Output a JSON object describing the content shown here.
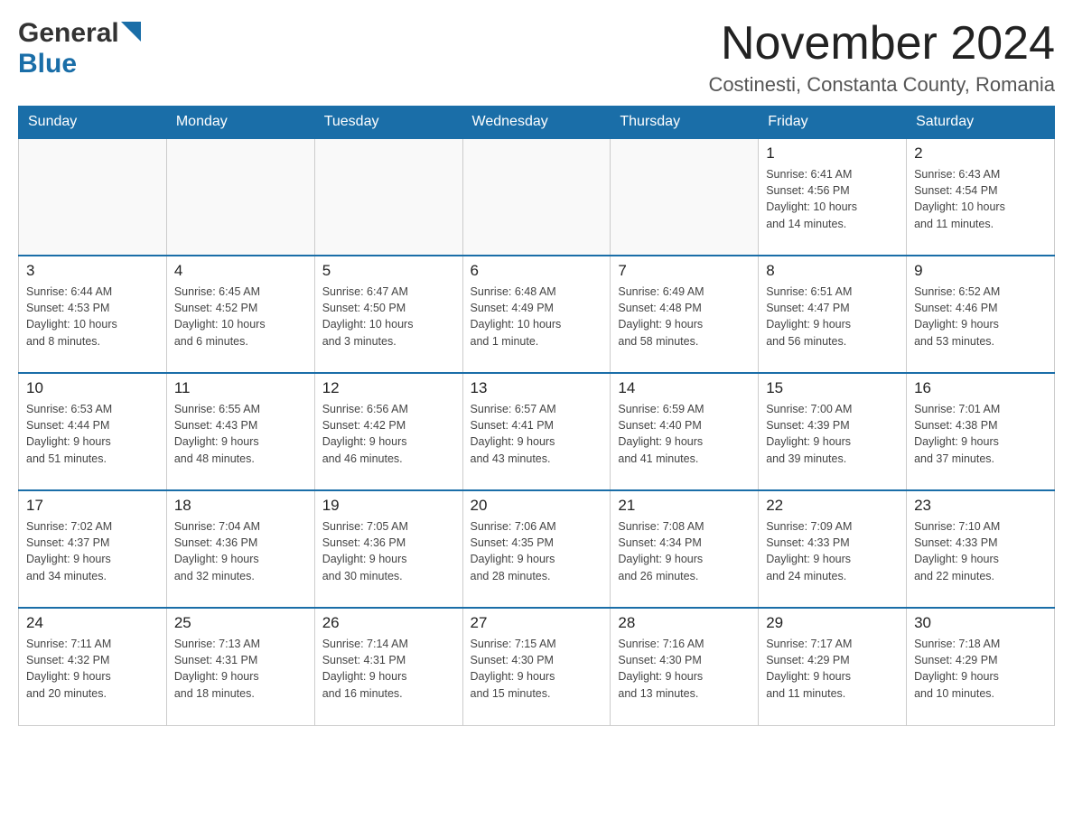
{
  "header": {
    "logo_general": "General",
    "logo_blue": "Blue",
    "month_title": "November 2024",
    "location": "Costinesti, Constanta County, Romania"
  },
  "weekdays": [
    "Sunday",
    "Monday",
    "Tuesday",
    "Wednesday",
    "Thursday",
    "Friday",
    "Saturday"
  ],
  "weeks": [
    [
      {
        "day": "",
        "info": ""
      },
      {
        "day": "",
        "info": ""
      },
      {
        "day": "",
        "info": ""
      },
      {
        "day": "",
        "info": ""
      },
      {
        "day": "",
        "info": ""
      },
      {
        "day": "1",
        "info": "Sunrise: 6:41 AM\nSunset: 4:56 PM\nDaylight: 10 hours\nand 14 minutes."
      },
      {
        "day": "2",
        "info": "Sunrise: 6:43 AM\nSunset: 4:54 PM\nDaylight: 10 hours\nand 11 minutes."
      }
    ],
    [
      {
        "day": "3",
        "info": "Sunrise: 6:44 AM\nSunset: 4:53 PM\nDaylight: 10 hours\nand 8 minutes."
      },
      {
        "day": "4",
        "info": "Sunrise: 6:45 AM\nSunset: 4:52 PM\nDaylight: 10 hours\nand 6 minutes."
      },
      {
        "day": "5",
        "info": "Sunrise: 6:47 AM\nSunset: 4:50 PM\nDaylight: 10 hours\nand 3 minutes."
      },
      {
        "day": "6",
        "info": "Sunrise: 6:48 AM\nSunset: 4:49 PM\nDaylight: 10 hours\nand 1 minute."
      },
      {
        "day": "7",
        "info": "Sunrise: 6:49 AM\nSunset: 4:48 PM\nDaylight: 9 hours\nand 58 minutes."
      },
      {
        "day": "8",
        "info": "Sunrise: 6:51 AM\nSunset: 4:47 PM\nDaylight: 9 hours\nand 56 minutes."
      },
      {
        "day": "9",
        "info": "Sunrise: 6:52 AM\nSunset: 4:46 PM\nDaylight: 9 hours\nand 53 minutes."
      }
    ],
    [
      {
        "day": "10",
        "info": "Sunrise: 6:53 AM\nSunset: 4:44 PM\nDaylight: 9 hours\nand 51 minutes."
      },
      {
        "day": "11",
        "info": "Sunrise: 6:55 AM\nSunset: 4:43 PM\nDaylight: 9 hours\nand 48 minutes."
      },
      {
        "day": "12",
        "info": "Sunrise: 6:56 AM\nSunset: 4:42 PM\nDaylight: 9 hours\nand 46 minutes."
      },
      {
        "day": "13",
        "info": "Sunrise: 6:57 AM\nSunset: 4:41 PM\nDaylight: 9 hours\nand 43 minutes."
      },
      {
        "day": "14",
        "info": "Sunrise: 6:59 AM\nSunset: 4:40 PM\nDaylight: 9 hours\nand 41 minutes."
      },
      {
        "day": "15",
        "info": "Sunrise: 7:00 AM\nSunset: 4:39 PM\nDaylight: 9 hours\nand 39 minutes."
      },
      {
        "day": "16",
        "info": "Sunrise: 7:01 AM\nSunset: 4:38 PM\nDaylight: 9 hours\nand 37 minutes."
      }
    ],
    [
      {
        "day": "17",
        "info": "Sunrise: 7:02 AM\nSunset: 4:37 PM\nDaylight: 9 hours\nand 34 minutes."
      },
      {
        "day": "18",
        "info": "Sunrise: 7:04 AM\nSunset: 4:36 PM\nDaylight: 9 hours\nand 32 minutes."
      },
      {
        "day": "19",
        "info": "Sunrise: 7:05 AM\nSunset: 4:36 PM\nDaylight: 9 hours\nand 30 minutes."
      },
      {
        "day": "20",
        "info": "Sunrise: 7:06 AM\nSunset: 4:35 PM\nDaylight: 9 hours\nand 28 minutes."
      },
      {
        "day": "21",
        "info": "Sunrise: 7:08 AM\nSunset: 4:34 PM\nDaylight: 9 hours\nand 26 minutes."
      },
      {
        "day": "22",
        "info": "Sunrise: 7:09 AM\nSunset: 4:33 PM\nDaylight: 9 hours\nand 24 minutes."
      },
      {
        "day": "23",
        "info": "Sunrise: 7:10 AM\nSunset: 4:33 PM\nDaylight: 9 hours\nand 22 minutes."
      }
    ],
    [
      {
        "day": "24",
        "info": "Sunrise: 7:11 AM\nSunset: 4:32 PM\nDaylight: 9 hours\nand 20 minutes."
      },
      {
        "day": "25",
        "info": "Sunrise: 7:13 AM\nSunset: 4:31 PM\nDaylight: 9 hours\nand 18 minutes."
      },
      {
        "day": "26",
        "info": "Sunrise: 7:14 AM\nSunset: 4:31 PM\nDaylight: 9 hours\nand 16 minutes."
      },
      {
        "day": "27",
        "info": "Sunrise: 7:15 AM\nSunset: 4:30 PM\nDaylight: 9 hours\nand 15 minutes."
      },
      {
        "day": "28",
        "info": "Sunrise: 7:16 AM\nSunset: 4:30 PM\nDaylight: 9 hours\nand 13 minutes."
      },
      {
        "day": "29",
        "info": "Sunrise: 7:17 AM\nSunset: 4:29 PM\nDaylight: 9 hours\nand 11 minutes."
      },
      {
        "day": "30",
        "info": "Sunrise: 7:18 AM\nSunset: 4:29 PM\nDaylight: 9 hours\nand 10 minutes."
      }
    ]
  ]
}
